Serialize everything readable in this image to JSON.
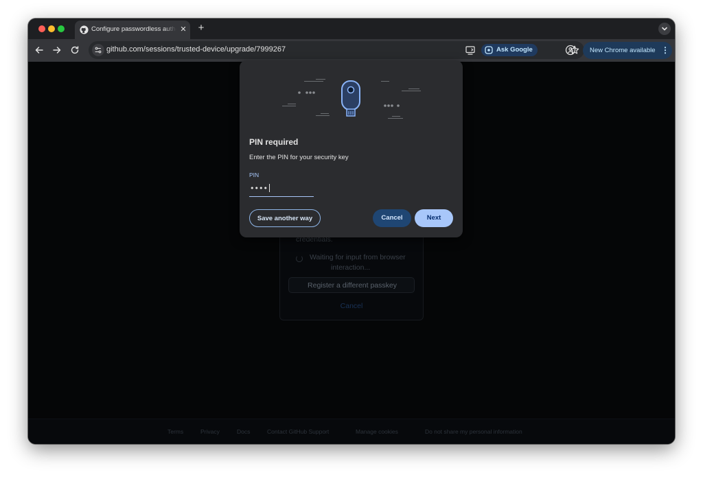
{
  "browser": {
    "tab": {
      "title": "Configure passwordless authentication",
      "favicon": "github-icon",
      "close_glyph": "✕"
    },
    "new_tab_glyph": "+",
    "address_bar": {
      "url": "github.com/sessions/trusted-device/upgrade/7999267"
    },
    "ask_google_label": "Ask Google",
    "update_label": "New Chrome available",
    "update_menu_glyph": "⋮"
  },
  "background_page": {
    "partial_text": "credentials.",
    "waiting_line1": "Waiting for input from browser",
    "waiting_line2": "interaction...",
    "register_button": "Register a different passkey",
    "cancel_link": "Cancel",
    "footer_links": [
      "Terms",
      "Privacy",
      "Docs",
      "Contact GitHub Support",
      "Manage cookies",
      "Do not share my personal information"
    ]
  },
  "dialog": {
    "illustration": "security-key-icon",
    "title": "PIN required",
    "subtitle": "Enter the PIN for your security key",
    "pin_label": "PIN",
    "pin_value": "••••",
    "save_another_way": "Save another way",
    "cancel": "Cancel",
    "next": "Next"
  },
  "colors": {
    "accent": "#a8c7fa",
    "dialog_bg": "#2b2c2f",
    "cancel_bg": "#1f4673"
  }
}
